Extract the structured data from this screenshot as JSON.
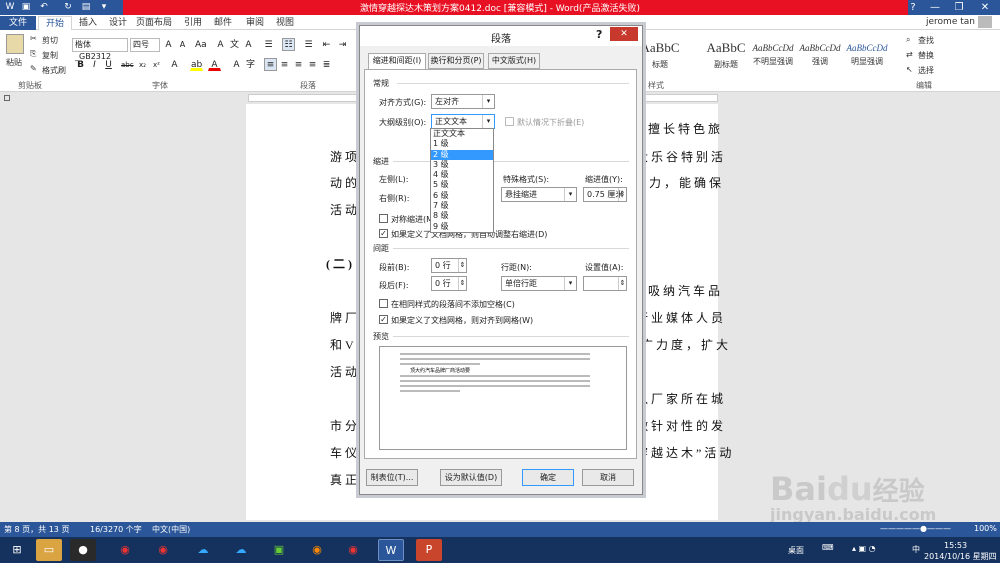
{
  "window": {
    "title": "激情穿越探达木策划方案0412.doc [兼容模式] - Word(产品激活失败)",
    "user": "jerome tan",
    "help": "?",
    "min": "—",
    "max": "❐",
    "close": "✕"
  },
  "tabs": [
    "文件",
    "开始",
    "插入",
    "设计",
    "页面布局",
    "引用",
    "邮件",
    "审阅",
    "视图"
  ],
  "ribbon": {
    "paste": "粘贴",
    "cut": "剪切",
    "copy": "复制",
    "format_painter": "格式刷",
    "font_name": "楷体_GB2312",
    "font_size": "四号",
    "groups": {
      "clipboard": "剪贴板",
      "font": "字体",
      "paragraph": "段落",
      "styles": "样式",
      "editing": "编辑"
    },
    "styles": [
      {
        "sample": "AaBbC",
        "label": "标题"
      },
      {
        "sample": "AaBbC",
        "label": "副标题"
      },
      {
        "sample": "AaBbCcDd",
        "label": "不明显强调"
      },
      {
        "sample": "AaBbCcDd",
        "label": "强调"
      },
      {
        "sample": "AaBbCcDd",
        "label": "明显强调"
      }
    ],
    "find": "查找",
    "replace": "替换",
    "select": "选择"
  },
  "document": {
    "lines": [
      "擅长特色旅",
      "游项",
      "大乐谷特别活",
      "动的",
      "实力，能确保",
      "活动",
      "(二)",
      "吸纳汽车品",
      "牌厂",
      "行业媒体人员",
      "和VI",
      "推广力度，扩大",
      "活动",
      "入厂家所在城",
      "市分",
      "做针对性的发",
      "车仪",
      "穿越达木”活动",
      "真正"
    ]
  },
  "status": {
    "page": "第 8 页，共 13 页",
    "words": "16/3270 个字",
    "lang": "中文(中国)",
    "zoom": "100%"
  },
  "taskbar": {
    "desktop": "桌面",
    "ime": "中",
    "time": "15:53",
    "date": "2014/10/16 星期四"
  },
  "dialog": {
    "title": "段落",
    "tabs": [
      "缩进和间距(I)",
      "换行和分页(P)",
      "中文版式(H)"
    ],
    "general": "常规",
    "align_label": "对齐方式(G):",
    "align_value": "左对齐",
    "outline_label": "大纲级别(O):",
    "outline_value": "正文文本",
    "collapse": "默认情况下折叠(E)",
    "indent": "缩进",
    "left": "左侧(L):",
    "right": "右侧(R):",
    "special_label": "特殊格式(S):",
    "special_value": "悬挂缩进",
    "indent_value_label": "缩进值(Y):",
    "indent_value": "0.75 厘米",
    "mirror": "对称缩进(M)",
    "auto_right": "如果定义了文档网格，则自动调整右缩进(D)",
    "spacing": "间距",
    "before_label": "段前(B):",
    "before_value": "0 行",
    "after_label": "段后(F):",
    "after_value": "0 行",
    "line_label": "行距(N):",
    "line_value": "单倍行距",
    "setting_label": "设置值(A):",
    "no_space": "在相同样式的段落间不添加空格(C)",
    "snap": "如果定义了文档网格，则对齐到网格(W)",
    "preview": "预览",
    "preview_text": "顶大约汽车品牌厂商活动要",
    "tabs_btn": "制表位(T)...",
    "default_btn": "设为默认值(D)",
    "ok": "确定",
    "cancel": "取消",
    "outline_options": [
      "正文文本",
      "1 级",
      "2 级",
      "3 级",
      "4 级",
      "5 级",
      "6 级",
      "7 级",
      "8 级",
      "9 级"
    ]
  },
  "watermark": {
    "brand": "Bai",
    "paw": "du",
    "cn": "经验",
    "url": "jingyan.baidu.com"
  },
  "colors": {
    "accent": "#2b579a",
    "selection": "#3399ff"
  }
}
